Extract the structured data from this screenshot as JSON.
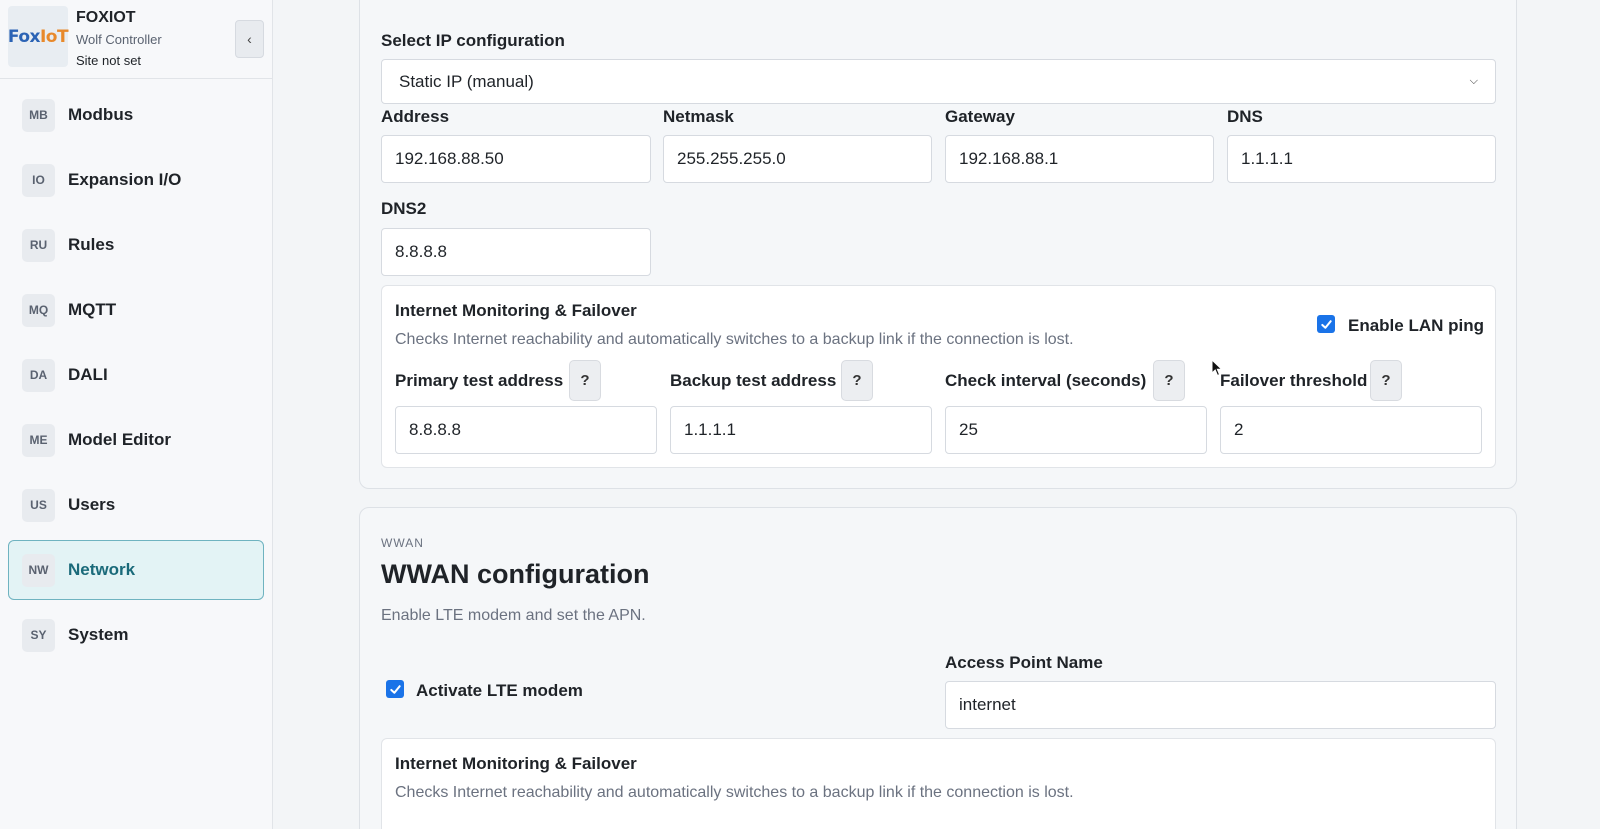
{
  "brand": {
    "logo_text_1": "Fox",
    "logo_text_2": "IoT",
    "name": "FOXIOT",
    "subtitle": "Wolf Controller",
    "site": "Site not set",
    "collapse_glyph": "‹"
  },
  "sidebar": {
    "items": [
      {
        "badge": "MB",
        "label": "Modbus",
        "active": false
      },
      {
        "badge": "IO",
        "label": "Expansion I/O",
        "active": false
      },
      {
        "badge": "RU",
        "label": "Rules",
        "active": false
      },
      {
        "badge": "MQ",
        "label": "MQTT",
        "active": false
      },
      {
        "badge": "DA",
        "label": "DALI",
        "active": false
      },
      {
        "badge": "ME",
        "label": "Model Editor",
        "active": false
      },
      {
        "badge": "US",
        "label": "Users",
        "active": false
      },
      {
        "badge": "NW",
        "label": "Network",
        "active": true
      },
      {
        "badge": "SY",
        "label": "System",
        "active": false
      }
    ]
  },
  "lan": {
    "ip_config_label": "Select IP configuration",
    "ip_config_value": "Static IP (manual)",
    "address_label": "Address",
    "address_value": "192.168.88.50",
    "netmask_label": "Netmask",
    "netmask_value": "255.255.255.0",
    "gateway_label": "Gateway",
    "gateway_value": "192.168.88.1",
    "dns_label": "DNS",
    "dns_value": "1.1.1.1",
    "dns2_label": "DNS2",
    "dns2_value": "8.8.8.8",
    "monitoring": {
      "title": "Internet Monitoring & Failover",
      "description": "Checks Internet reachability and automatically switches to a backup link if the connection is lost.",
      "ping_label": "Enable LAN ping",
      "ping_checked": true,
      "primary_label": "Primary test address",
      "primary_value": "8.8.8.8",
      "backup_label": "Backup test address",
      "backup_value": "1.1.1.1",
      "interval_label": "Check interval (seconds)",
      "interval_value": "25",
      "threshold_label": "Failover threshold",
      "threshold_value": "2",
      "help_glyph": "?"
    }
  },
  "wwan": {
    "overline": "WWAN",
    "title": "WWAN configuration",
    "description": "Enable LTE modem and set the APN.",
    "lte_label": "Activate LTE modem",
    "lte_checked": true,
    "apn_label": "Access Point Name",
    "apn_value": "internet",
    "monitoring": {
      "title": "Internet Monitoring & Failover",
      "description": "Checks Internet reachability and automatically switches to a backup link if the connection is lost."
    }
  },
  "colors": {
    "accent": "#1a73e8",
    "active_nav_bg": "#e3f3f5",
    "active_nav_text": "#1a6a7a"
  }
}
